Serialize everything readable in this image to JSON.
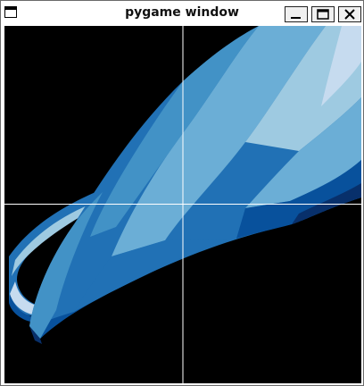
{
  "window": {
    "title": "pygame window",
    "icon": "window-app-icon",
    "controls": [
      {
        "name": "minimize-button",
        "icon": "minimize-icon"
      },
      {
        "name": "maximize-button",
        "icon": "maximize-icon"
      },
      {
        "name": "close-button",
        "icon": "close-icon"
      }
    ]
  },
  "canvas": {
    "background": "#000000",
    "crosshair_color": "#ffffff",
    "palette": [
      "#08306b",
      "#08519c",
      "#2171b5",
      "#4292c6",
      "#6baed6",
      "#9ecae1",
      "#c6dbef"
    ]
  }
}
